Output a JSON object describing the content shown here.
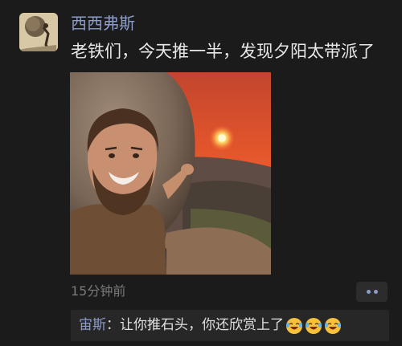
{
  "post": {
    "author": "西西弗斯",
    "content": "老铁们，今天推一半，发现夕阳太带派了",
    "time": "15分钟前",
    "more_icon": "more-dots-icon",
    "photo_icon": "selfie-sunset-boulder-photo"
  },
  "comments": [
    {
      "author": "宙斯",
      "separator": "：",
      "text": "让你推石头，你还欣赏上了",
      "emoji_count": 3,
      "emoji_icon": "laughing-tears-emoji"
    }
  ],
  "colors": {
    "background": "#1b1b1b",
    "name_blue": "#8c9cc8",
    "text": "#e8e8e8",
    "time_gray": "#7a7a7a",
    "comment_bg": "#272727"
  }
}
